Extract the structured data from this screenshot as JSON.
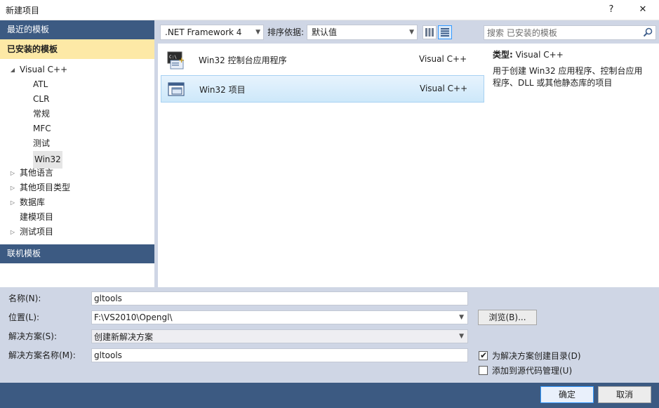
{
  "window": {
    "title": "新建项目",
    "help": "?",
    "close": "✕"
  },
  "left": {
    "recent": "最近的模板",
    "installed": "已安装的模板",
    "online": "联机模板",
    "tree": [
      {
        "label": "Visual C++",
        "arrow": "◢",
        "level": 0
      },
      {
        "label": "ATL",
        "arrow": "",
        "level": 1
      },
      {
        "label": "CLR",
        "arrow": "",
        "level": 1
      },
      {
        "label": "常规",
        "arrow": "",
        "level": 1
      },
      {
        "label": "MFC",
        "arrow": "",
        "level": 1
      },
      {
        "label": "测试",
        "arrow": "",
        "level": 1
      },
      {
        "label": "Win32",
        "arrow": "",
        "level": 1,
        "selected": true
      },
      {
        "label": "其他语言",
        "arrow": "▷",
        "level": 0
      },
      {
        "label": "其他项目类型",
        "arrow": "▷",
        "level": 0
      },
      {
        "label": "数据库",
        "arrow": "▷",
        "level": 0
      },
      {
        "label": "建模项目",
        "arrow": "",
        "level": 0
      },
      {
        "label": "测试项目",
        "arrow": "▷",
        "level": 0
      }
    ]
  },
  "toolbar": {
    "framework": ".NET Framework 4",
    "sort_label": "排序依据:",
    "sort_value": "默认值"
  },
  "templates": [
    {
      "name": "Win32 控制台应用程序",
      "lang": "Visual C++",
      "icon": "console-app-icon"
    },
    {
      "name": "Win32 项目",
      "lang": "Visual C++",
      "icon": "win32-project-icon"
    }
  ],
  "search": {
    "placeholder": "搜索 已安装的模板"
  },
  "details": {
    "type_key": "类型:",
    "type_value": "Visual C++",
    "description": "用于创建 Win32 应用程序、控制台应用程序、DLL 或其他静态库的项目"
  },
  "form": {
    "name_label": "名称(N):",
    "name_value": "gltools",
    "location_label": "位置(L):",
    "location_value": "F:\\VS2010\\Opengl\\",
    "solution_label": "解决方案(S):",
    "solution_value": "创建新解决方案",
    "solution_name_label": "解决方案名称(M):",
    "solution_name_value": "gltools",
    "browse": "浏览(B)...",
    "create_dir": "为解决方案创建目录(D)",
    "add_source_control": "添加到源代码管理(U)",
    "create_dir_checked": true,
    "add_source_control_checked": false
  },
  "buttons": {
    "ok": "确定",
    "cancel": "取消"
  },
  "colors": {
    "header": "#3c5a82",
    "installed": "#fde9a6",
    "frame": "#cfd6e5",
    "selection": "#cde8fa"
  }
}
